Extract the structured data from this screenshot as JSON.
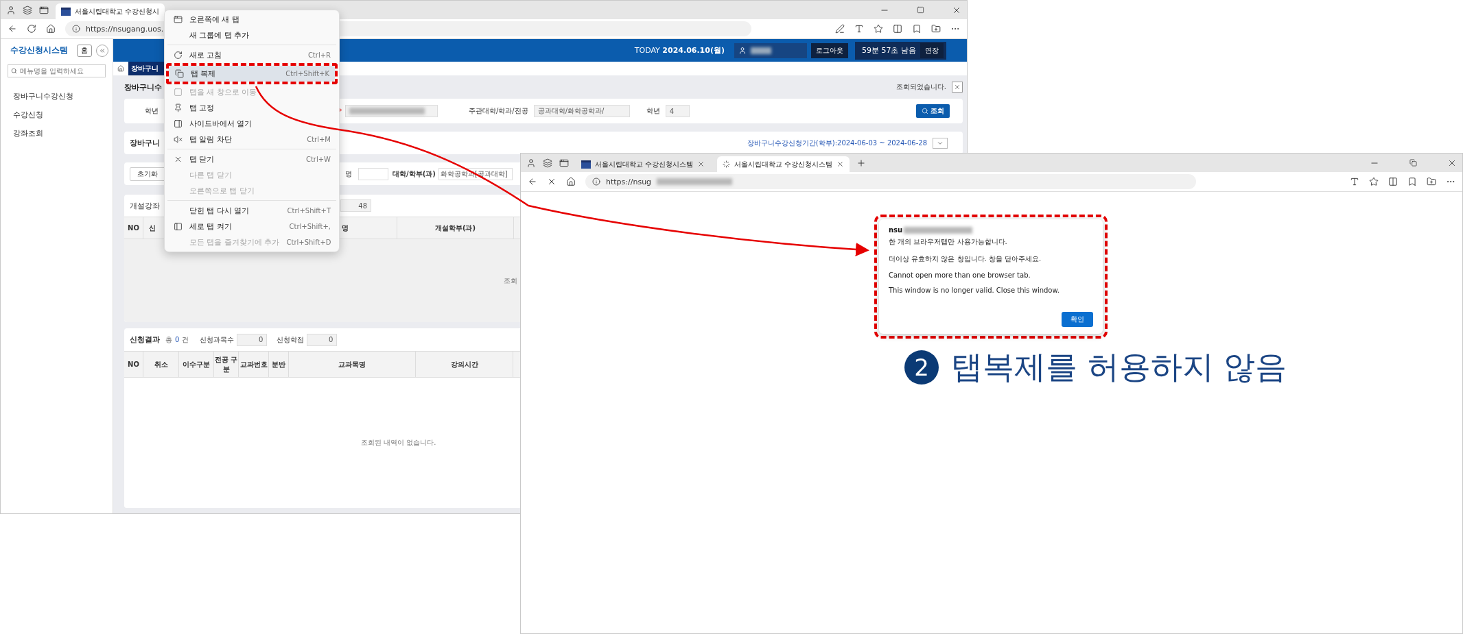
{
  "left_browser": {
    "tab": {
      "title": "서울시립대학교 수강신청시",
      "selected": true
    },
    "url": "https://nsugang.uos."
  },
  "app": {
    "title": "수강신청시스템",
    "home_button": "홈",
    "search": {
      "placeholder": "메뉴명을 입력하세요"
    },
    "sidebar": {
      "items": [
        {
          "label": "장바구니수강신청"
        },
        {
          "label": "수강신청"
        },
        {
          "label": "강좌조회"
        }
      ]
    },
    "header": {
      "today_label": "TODAY",
      "date": "2024.06.10(월)",
      "logout_button": "로그아웃",
      "timer": "59분 57초 남음",
      "extend_button": "연장"
    },
    "breadcrumb_tab": "장바구니",
    "page_title": "장바구니수",
    "status_message": "조회되었습니다.",
    "search_card": {
      "year_label": "학년",
      "required_mark": "*",
      "dept_label": "주관대학/학과/전공",
      "dept_value": "공과대학/화학공학과/",
      "grade_label": "학년",
      "grade_value": "4",
      "search_button": "조회"
    },
    "cart_card": {
      "title": "장바구니",
      "period": "장바구니수강신청기간(학부):2024-06-03 ~ 2024-06-28"
    },
    "filter_card": {
      "reset_button": "초기화",
      "name_label": "명",
      "college_label": "대학/학부(과)",
      "college_value": "화학공학과[공과대학]"
    },
    "courses": {
      "title": "개설강좌",
      "count": "48",
      "columns": [
        "NO",
        "신",
        "명",
        "개설학부(과)"
      ],
      "empty_text": "조회"
    },
    "results": {
      "title": "신청결과",
      "total_prefix": "총",
      "total": "0",
      "total_suffix": "건",
      "count_label": "신청과목수",
      "count_value": "0",
      "credit_label": "신청학점",
      "credit_value": "0",
      "columns": [
        "NO",
        "취소",
        "이수구분",
        "전공 구분",
        "교과번호",
        "분반",
        "교과목명",
        "강의시간"
      ],
      "empty_text": "조회된 내역이 없습니다."
    }
  },
  "context_menu": {
    "items": [
      {
        "kind": "item",
        "label": "오른쪽에 새 탭",
        "disabled": false,
        "selected": false
      },
      {
        "kind": "item",
        "label": "새 그룹에 탭 추가",
        "disabled": false,
        "selected": false
      },
      {
        "kind": "separator"
      },
      {
        "kind": "item",
        "label": "새로 고침",
        "shortcut": "Ctrl+R",
        "disabled": false,
        "selected": false
      },
      {
        "kind": "item",
        "label": "탭 복제",
        "shortcut": "Ctrl+Shift+K",
        "disabled": false,
        "selected": true
      },
      {
        "kind": "item",
        "label": "탭을 새 창으로 이동",
        "disabled": true,
        "selected": false
      },
      {
        "kind": "item",
        "label": "탭 고정",
        "disabled": false,
        "selected": false
      },
      {
        "kind": "item",
        "label": "사이드바에서 열기",
        "disabled": false,
        "selected": false
      },
      {
        "kind": "item",
        "label": "탭 알림 차단",
        "shortcut": "Ctrl+M",
        "disabled": false,
        "selected": false
      },
      {
        "kind": "separator"
      },
      {
        "kind": "item",
        "label": "탭 닫기",
        "shortcut": "Ctrl+W",
        "disabled": false,
        "selected": false
      },
      {
        "kind": "item",
        "label": "다른 탭 닫기",
        "disabled": true,
        "selected": false
      },
      {
        "kind": "item",
        "label": "오른쪽으로 탭 닫기",
        "disabled": true,
        "selected": false
      },
      {
        "kind": "separator"
      },
      {
        "kind": "item",
        "label": "닫힌 탭 다시 열기",
        "shortcut": "Ctrl+Shift+T",
        "disabled": false,
        "selected": false
      },
      {
        "kind": "item",
        "label": "세로 탭 켜기",
        "shortcut": "Ctrl+Shift+,",
        "disabled": false,
        "selected": false
      },
      {
        "kind": "item",
        "label": "모든 탭을 즐겨찾기에 추가",
        "shortcut": "Ctrl+Shift+D",
        "disabled": true,
        "selected": false
      }
    ]
  },
  "right_browser": {
    "tabs": [
      {
        "title": "서울시립대학교 수강신청시스템",
        "selected": false
      },
      {
        "title": "서울시립대학교 수강신청시스템",
        "selected": true
      }
    ],
    "url": "https://nsug",
    "dialog": {
      "title": "nsu",
      "lines": [
        "한 개의 브라우저탭만 사용가능합니다.",
        "더이상 유효하지 않은 창입니다. 창을 닫아주세요.",
        "Cannot open more than one browser tab.",
        "This window is no longer valid. Close this window."
      ],
      "ok_button": "확인"
    }
  },
  "annotation": {
    "number": "2",
    "text": "탭복제를 허용하지 않음"
  }
}
